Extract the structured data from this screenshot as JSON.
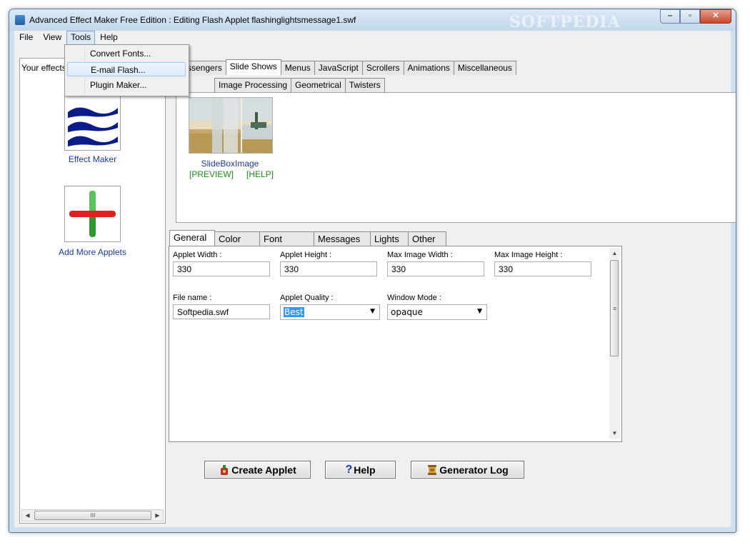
{
  "window": {
    "title": "Advanced Effect Maker Free Edition : Editing Flash Applet flashinglightsmessage1.swf",
    "watermark": "SOFTPEDIA",
    "minimize_glyph": "‒",
    "maximize_glyph": "▫",
    "close_glyph": "✕"
  },
  "menubar": {
    "items": [
      {
        "label": "File"
      },
      {
        "label": "View"
      },
      {
        "label": "Tools"
      },
      {
        "label": "Help"
      }
    ]
  },
  "tools_menu": {
    "items": [
      {
        "label": "Convert Fonts..."
      },
      {
        "label": "E-mail Flash..."
      },
      {
        "label": "Plugin Maker..."
      }
    ]
  },
  "left_pane": {
    "label": "Your effects",
    "applets": [
      {
        "caption": "Effect Maker",
        "icon": "waves-icon"
      },
      {
        "caption": "Add More Applets",
        "icon": "plus-icon"
      }
    ],
    "scroll_grip": "III"
  },
  "category_tabs": {
    "items": [
      "ssengers",
      "Slide Shows",
      "Menus",
      "JavaScript",
      "Scrollers",
      "Animations",
      "Miscellaneous"
    ],
    "active": "Slide Shows"
  },
  "subcategory_tabs": {
    "items": [
      "Image Processing",
      "Geometrical",
      "Twisters"
    ]
  },
  "gallery": {
    "items": [
      {
        "caption": "SlideBoxImage",
        "preview": "[PREVIEW]",
        "help": "[HELP]"
      }
    ]
  },
  "property_tabs": {
    "items": [
      "General",
      "Color",
      "Font",
      "Messages",
      "Lights",
      "Other"
    ],
    "active": "General"
  },
  "general_form": {
    "applet_width": {
      "label": "Applet Width :",
      "value": "330"
    },
    "applet_height": {
      "label": "Applet Height :",
      "value": "330"
    },
    "max_image_width": {
      "label": "Max Image Width :",
      "value": "330"
    },
    "max_image_height": {
      "label": "Max Image Height :",
      "value": "330"
    },
    "file_name": {
      "label": "File name :",
      "value": "Softpedia.swf"
    },
    "applet_quality": {
      "label": "Applet Quality :",
      "value": "Best"
    },
    "window_mode": {
      "label": "Window Mode :",
      "value": "opaque"
    }
  },
  "actions": {
    "create_applet": "Create Applet",
    "help": "Help",
    "generator_log": "Generator Log"
  },
  "colors": {
    "link_blue": "#1a3a9a",
    "link_green": "#1f8a1f",
    "selection": "#3399ff"
  }
}
